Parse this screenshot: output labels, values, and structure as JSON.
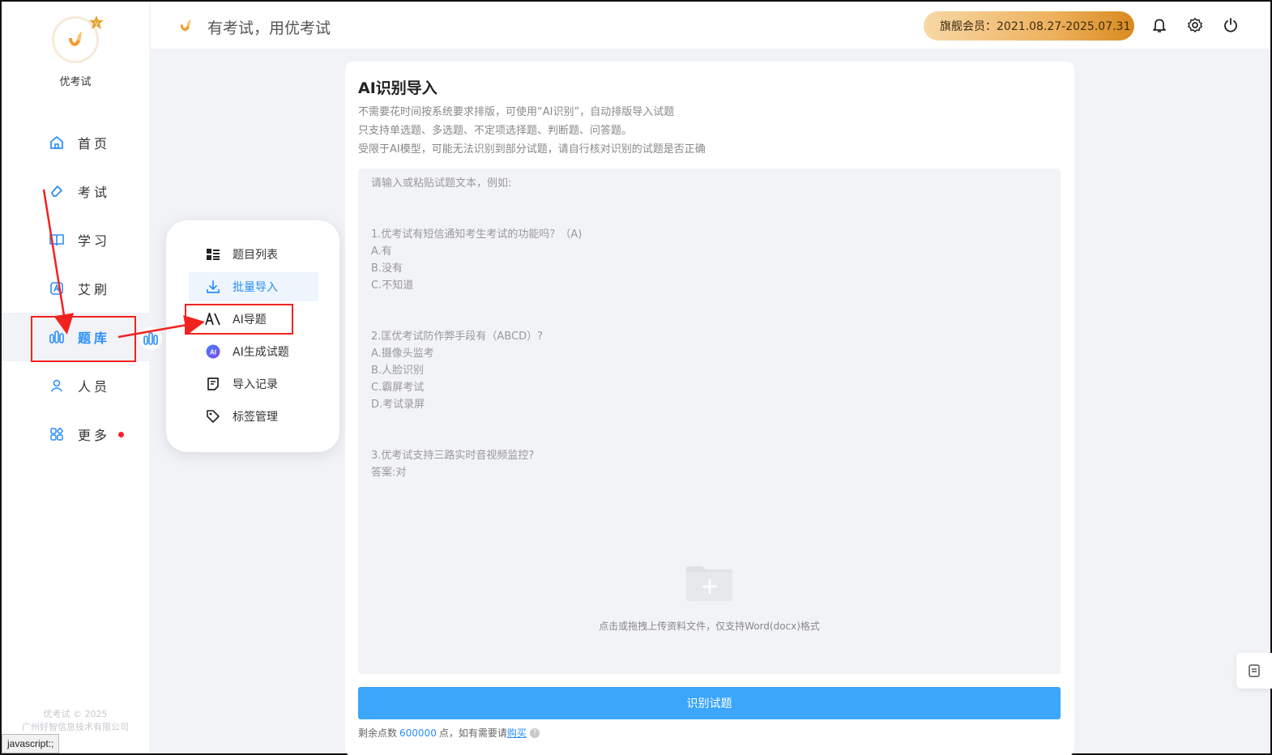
{
  "sidebar": {
    "brand": "优考试",
    "items": [
      {
        "label": "首页",
        "icon": "home-icon"
      },
      {
        "label": "考试",
        "icon": "eraser-icon"
      },
      {
        "label": "学习",
        "icon": "book-icon"
      },
      {
        "label": "艾刷",
        "icon": "brush-icon"
      },
      {
        "label": "题库",
        "icon": "question-bank-icon"
      },
      {
        "label": "人员",
        "icon": "user-icon"
      },
      {
        "label": "更多",
        "icon": "apps-icon"
      }
    ],
    "footer_line1": "优考试 © 2025",
    "footer_line2": "广州好智信息技术有限公司"
  },
  "status_bar": "javascript:;",
  "header": {
    "slogan": "有考试，用优考试",
    "vip": "旗舰会员：2021.08.27-2025.07.31"
  },
  "flyout": {
    "items": [
      {
        "label": "题目列表",
        "icon": "list-icon"
      },
      {
        "label": "批量导入",
        "icon": "download-icon"
      },
      {
        "label": "AI导题",
        "icon": "ai-import-icon"
      },
      {
        "label": "AI生成试题",
        "icon": "ai-generate-icon"
      },
      {
        "label": "导入记录",
        "icon": "record-icon"
      },
      {
        "label": "标签管理",
        "icon": "tag-icon"
      }
    ]
  },
  "main": {
    "title": "AI识别导入",
    "desc": [
      "不需要花时间按系统要求排版，可使用“AI识别”，自动排版导入试题",
      "只支持单选题、多选题、不定项选择题、判断题、问答题。",
      "受限于AI模型，可能无法识别到部分试题，请自行核对识别的试题是否正确"
    ],
    "placeholder_lines": [
      "请输入或粘贴试题文本，例如:",
      "",
      "",
      "1.优考试有短信通知考生考试的功能吗？（A)",
      "A.有",
      "B.没有",
      "C.不知道",
      "",
      "",
      "2.匡优考试防作弊手段有（ABCD）?",
      "A.摄像头监考",
      "B.人脸识别",
      "C.霸屏考试",
      "D.考试录屏",
      "",
      "",
      "3.优考试支持三路实时音视频监控?",
      "答案:对"
    ],
    "upload_hint": "点击或拖拽上传资料文件，仅支持Word(docx)格式",
    "button": "识别试题",
    "points_prefix": "剩余点数",
    "points_value": "600000",
    "points_suffix": "点，如有需要请",
    "points_link": "购买"
  },
  "colors": {
    "accent": "#3ba6fa",
    "annotation": "#f2221f",
    "vip": "#eeb25f"
  }
}
